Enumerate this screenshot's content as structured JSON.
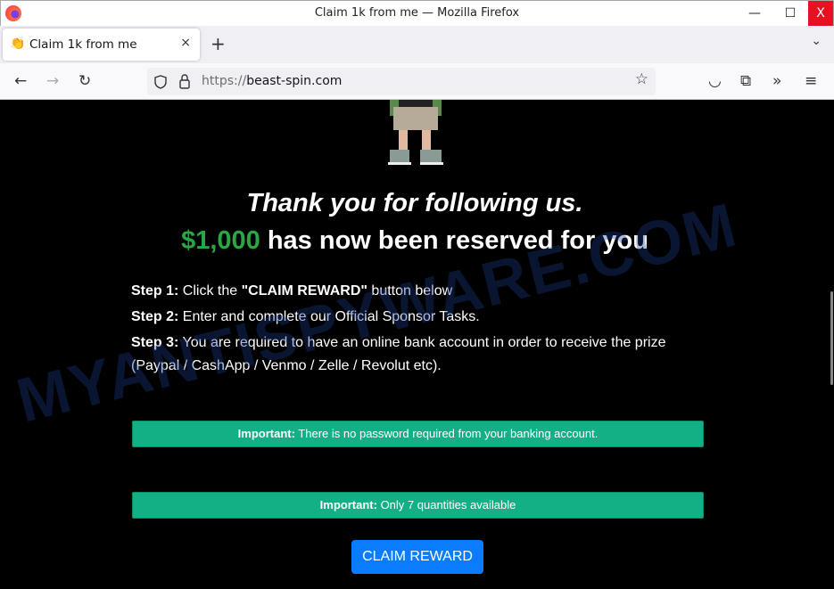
{
  "window": {
    "title": "Claim 1k from me — Mozilla Firefox",
    "minimize": "—",
    "maximize": "☐",
    "close": "X"
  },
  "tab": {
    "favicon": "👏",
    "label": "Claim 1k from me",
    "close": "×",
    "new_tab": "+",
    "list": "⌄"
  },
  "nav": {
    "back": "←",
    "forward": "→",
    "reload": "↻",
    "url_scheme": "https://",
    "url_host": "beast-spin.com",
    "bookmark": "☆",
    "pocket": "◡",
    "extensions": "⧉",
    "overflow": "»",
    "menu": "≡"
  },
  "page": {
    "heading": "Thank you for following us.",
    "amount": "$1,000",
    "subheading": " has now been reserved for you",
    "steps": [
      {
        "label": "Step 1:",
        "pre": " Click the ",
        "strong": "\"CLAIM REWARD\"",
        "post": " button below"
      },
      {
        "label": "Step 2:",
        "text": " Enter and complete our Official Sponsor Tasks."
      },
      {
        "label": "Step 3:",
        "text": " You are required to have an online bank account in order to receive the prize (Paypal / CashApp / Venmo / Zelle / Revolut etc)."
      }
    ],
    "alerts": [
      {
        "label": "Important:",
        "text": " There is no password required from your banking account."
      },
      {
        "label": "Important:",
        "text": " Only 7 quantities available"
      }
    ],
    "button": "CLAIM REWARD",
    "watermark": "MYANTISPYWARE.COM"
  },
  "colors": {
    "alert": "#13b085",
    "button": "#0a7cff",
    "amount": "#28a745"
  }
}
